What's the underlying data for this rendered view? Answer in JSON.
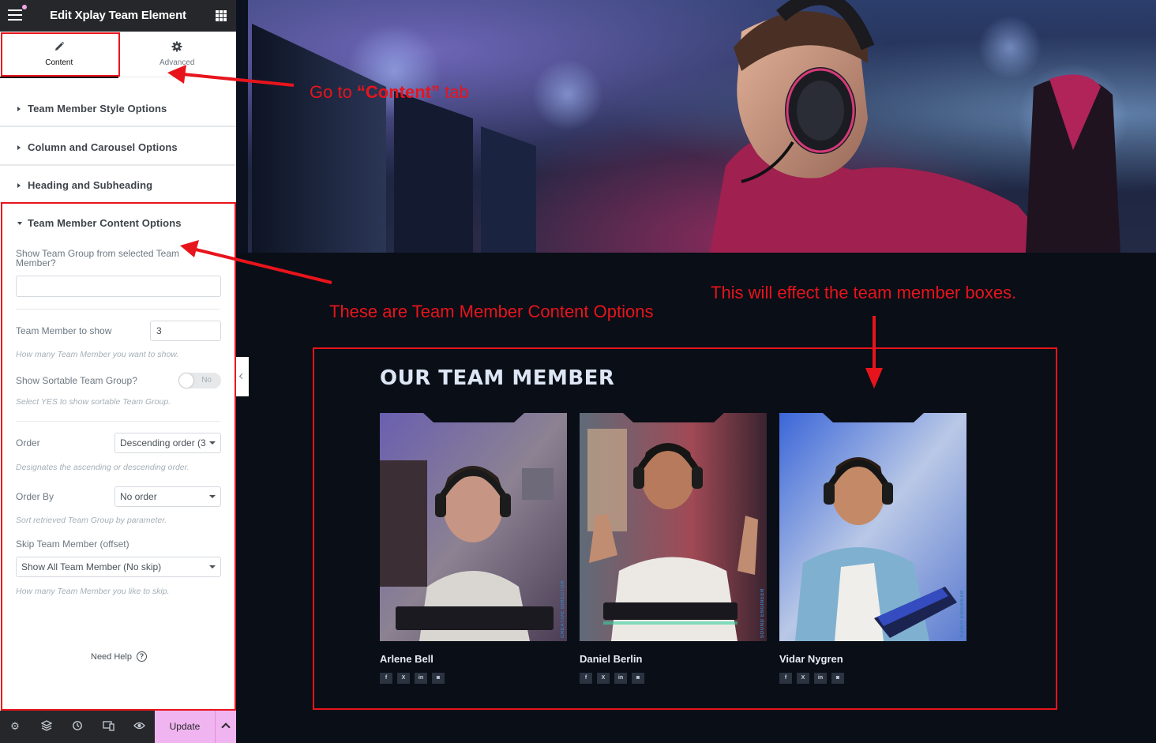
{
  "editor": {
    "title": "Edit Xplay Team Element",
    "tabs": [
      {
        "label": "Content",
        "icon": "pencil-icon",
        "active": true
      },
      {
        "label": "Advanced",
        "icon": "gear-icon",
        "active": false
      }
    ],
    "sections": [
      {
        "label": "Team Member Style Options",
        "open": false
      },
      {
        "label": "Column and Carousel Options",
        "open": false
      },
      {
        "label": "Heading and Subheading",
        "open": false
      },
      {
        "label": "Team Member Content Options",
        "open": true
      }
    ],
    "controls": {
      "show_group_label": "Show Team Group from selected Team Member?",
      "show_group_value": "",
      "members_to_show_label": "Team Member to show",
      "members_to_show_value": "3",
      "members_to_show_desc": "How many Team Member you want to show.",
      "sortable_label": "Show Sortable Team Group?",
      "sortable_toggle_text": "No",
      "sortable_desc": "Select YES to show sortable Team Group.",
      "order_label": "Order",
      "order_value": "Descending order (3",
      "order_desc": "Designates the ascending or descending order.",
      "order_by_label": "Order By",
      "order_by_value": "No order",
      "order_by_desc": "Sort retrieved Team Group by parameter.",
      "skip_label": "Skip Team Member (offset)",
      "skip_value": "Show All Team Member (No skip)",
      "skip_desc": "How many Team Member you like to skip."
    },
    "need_help": "Need Help",
    "update_label": "Update"
  },
  "preview": {
    "team_heading": "OUR TEAM MEMBER",
    "members": [
      {
        "name": "Arlene Bell",
        "role": "CREATIVE DIRECTOR",
        "socials": [
          "f",
          "X",
          "in",
          "ig"
        ]
      },
      {
        "name": "Daniel Berlin",
        "role": "SOUND ENGINEER",
        "socials": [
          "f",
          "X",
          "in",
          "ig"
        ]
      },
      {
        "name": "Vidar Nygren",
        "role": "AUDIO ENGINEER",
        "socials": [
          "f",
          "X",
          "in",
          "ig"
        ]
      }
    ]
  },
  "annotations": {
    "content_tab_prefix": "Go  to ",
    "content_tab_quoted": "“Content”",
    "content_tab_suffix": " tab",
    "content_options_note": "These are Team Member Content Options",
    "boxes_note": "This will effect the team member boxes.",
    "color": "#e8141c"
  },
  "colors": {
    "editor_dark": "#26272b",
    "update_button": "#f0b4f0",
    "preview_bg": "#0a0e16"
  }
}
